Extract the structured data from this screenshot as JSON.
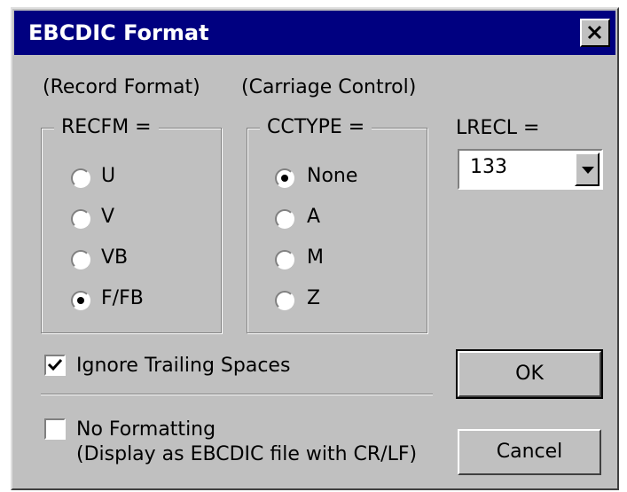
{
  "dialog": {
    "title": "EBCDIC Format",
    "close_label": "✕"
  },
  "labels": {
    "record_format": "(Record Format)",
    "carriage_control": "(Carriage Control)",
    "lrecl": "LRECL ="
  },
  "recfm": {
    "legend": "RECFM =",
    "options": [
      "U",
      "V",
      "VB",
      "F/FB"
    ],
    "selected": "F/FB"
  },
  "cctype": {
    "legend": "CCTYPE =",
    "options": [
      "None",
      "A",
      "M",
      "Z"
    ],
    "selected": "None"
  },
  "lrecl_combo": {
    "value": "133"
  },
  "checkboxes": {
    "ignore_trailing": {
      "label": "Ignore Trailing Spaces",
      "checked": true
    },
    "no_formatting": {
      "label_line1": "No Formatting",
      "label_line2": "(Display as EBCDIC file with CR/LF)",
      "checked": false
    }
  },
  "buttons": {
    "ok": "OK",
    "cancel": "Cancel"
  }
}
